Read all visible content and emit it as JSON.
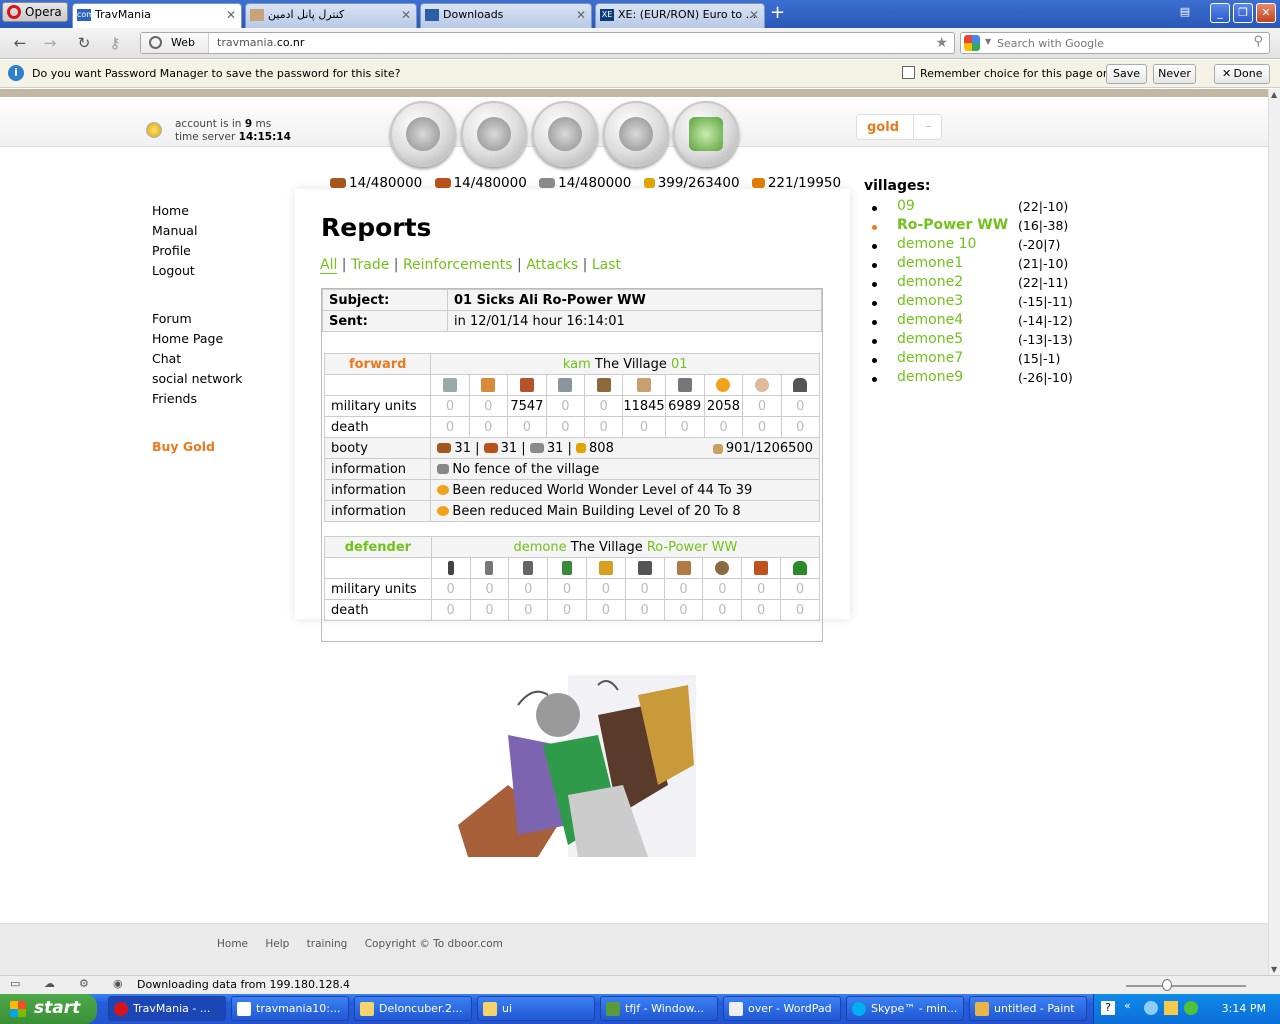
{
  "browser": {
    "opera_label": "Opera",
    "tabs": [
      {
        "title": "TravMania",
        "favicon": "com"
      },
      {
        "title": "کنترل پانل ادمین"
      },
      {
        "title": "Downloads"
      },
      {
        "title": "XE: (EUR/RON) Euro to ...",
        "favicon": "XE"
      }
    ],
    "web_label": "Web",
    "url_host": "travmania.",
    "url_domain": "co.nr",
    "search_placeholder": "Search with Google",
    "password_bar": {
      "text": "Do you want Password Manager to save the password for this site?",
      "remember": "Remember choice for this page only",
      "save": "Save",
      "never": "Never",
      "done": "Done"
    }
  },
  "header": {
    "account_pre": "account is in",
    "account_ms": "9",
    "account_unit": "ms",
    "time_label": "time server",
    "time": "14:15:14",
    "gold": "gold",
    "gold_sep": "–"
  },
  "resources": [
    {
      "value": "14/480000",
      "color": "#a4561c",
      "icon": "wood-icon"
    },
    {
      "value": "14/480000",
      "color": "#b7501b",
      "icon": "clay-icon"
    },
    {
      "value": "14/480000",
      "color": "#8a8a8a",
      "icon": "iron-icon"
    },
    {
      "value": "399/263400",
      "color": "#e0a400",
      "icon": "crop-icon"
    },
    {
      "value": "221/19950",
      "color": "#e07a00",
      "icon": "consumption-icon"
    }
  ],
  "left_menu": {
    "home": "Home",
    "manual": "Manual",
    "profile": "Profile",
    "logout": "Logout",
    "forum": "Forum",
    "homepage": "Home Page",
    "chat": "Chat",
    "social": "social network",
    "friends": "Friends",
    "buy_gold": "Buy Gold"
  },
  "reports": {
    "title": "Reports",
    "nav": [
      "All",
      "Trade",
      "Reinforcements",
      "Attacks",
      "Last"
    ],
    "subject_label": "Subject:",
    "subject": "01 Sicks Ali Ro-Power WW",
    "sent_label": "Sent:",
    "sent": "in 12/01/14 hour 16:14:01",
    "attacker": {
      "role": "forward",
      "player": "kam",
      "village_label": "The Village",
      "village": "01",
      "units_label": "military units",
      "death_label": "death",
      "units": [
        "0",
        "0",
        "7547",
        "0",
        "0",
        "11845",
        "6989",
        "2058",
        "0",
        "0"
      ],
      "deaths": [
        "0",
        "0",
        "0",
        "0",
        "0",
        "0",
        "0",
        "0",
        "0",
        "0"
      ],
      "booty_label": "booty",
      "booty": {
        "wood": "31",
        "clay": "31",
        "iron": "31",
        "crop": "808",
        "carry": "901/1206500"
      },
      "info_label": "information",
      "info": [
        "No fence of the village",
        "Been reduced World Wonder Level of 44 To 39",
        "Been reduced Main Building Level of 20 To 8"
      ]
    },
    "defender": {
      "role": "defender",
      "player": "demone",
      "village_label": "The Village",
      "village": "Ro-Power WW",
      "units_label": "military units",
      "death_label": "death",
      "units": [
        "0",
        "0",
        "0",
        "0",
        "0",
        "0",
        "0",
        "0",
        "0",
        "0"
      ],
      "deaths": [
        "0",
        "0",
        "0",
        "0",
        "0",
        "0",
        "0",
        "0",
        "0",
        "0"
      ]
    }
  },
  "villages": {
    "title": "villages:",
    "list": [
      {
        "name": "09",
        "coords": "(22|-10)"
      },
      {
        "name": "Ro-Power WW",
        "coords": "(16|-38)",
        "current": true
      },
      {
        "name": "demone 10",
        "coords": "(-20|7)"
      },
      {
        "name": "demone1",
        "coords": "(21|-10)"
      },
      {
        "name": "demone2",
        "coords": "(22|-11)"
      },
      {
        "name": "demone3",
        "coords": "(-15|-11)"
      },
      {
        "name": "demone4",
        "coords": "(-14|-12)"
      },
      {
        "name": "demone5",
        "coords": "(-13|-13)"
      },
      {
        "name": "demone7",
        "coords": "(15|-1)"
      },
      {
        "name": "demone9",
        "coords": "(-26|-10)"
      }
    ]
  },
  "footer": {
    "home": "Home",
    "help": "Help",
    "training": "training",
    "copyright": "Copyright © To dboor.com"
  },
  "status": "Downloading data from 199.180.128.4",
  "taskbar": {
    "start": "start",
    "tasks": [
      "TravMania - ...",
      "travmania10:...",
      "DeIoncuber.2...",
      "ui",
      "tfjf - Window...",
      "over - WordPad",
      "Skype™ - min...",
      "untitled - Paint"
    ],
    "time": "3:14 PM"
  }
}
